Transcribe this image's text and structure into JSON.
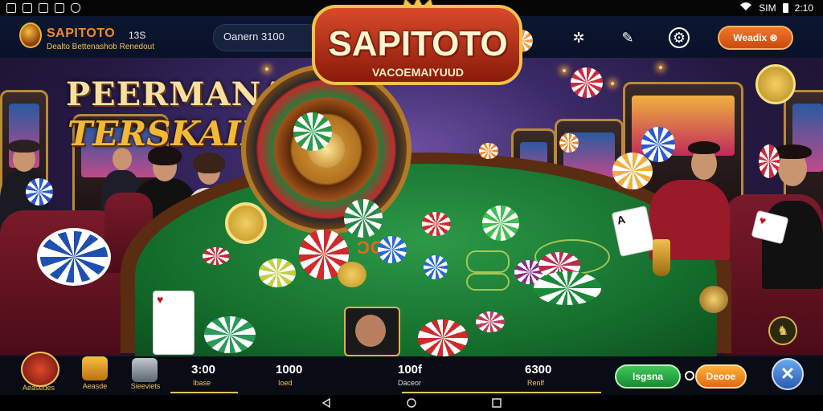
{
  "status_bar": {
    "left_icons": [
      "sim-icon",
      "photo-icon",
      "notification-icon",
      "app-icon",
      "shield-icon"
    ],
    "signal_text": "SIM",
    "time": "2:10"
  },
  "header": {
    "brand": "SAPITOTO",
    "brand_suffix": "13S",
    "brand_subtitle": "Dealto Bettenashob Renedout",
    "balance_text": "Oanern 3100",
    "menu_button": "Weadix"
  },
  "hero": {
    "title_line_1": "PEERMANAN",
    "title_line_2": "TERSKAIRO",
    "center_title": "SAPITOTO",
    "center_subtitle": "VACOEMAIYUUD",
    "felt_label": "ƆCO"
  },
  "bottom_bar": {
    "nav_items": [
      {
        "label": "Aeasedes"
      },
      {
        "label": "Aeasde"
      },
      {
        "label": "Sieeviets"
      }
    ],
    "stats": [
      {
        "value": "3:00",
        "sub": "Ibase"
      },
      {
        "value": "1000",
        "sub": "Ioed"
      },
      {
        "value": "100f",
        "sub": "Daceor"
      },
      {
        "value": "6300",
        "sub": "Renlf"
      }
    ],
    "green_button": "Isgsna",
    "orange_button": "Deooe"
  },
  "colors": {
    "accent_orange": "#e9641e",
    "gold": "#f3c35a",
    "felt_green": "#1e8a3a",
    "header_bg": "#0c1630"
  }
}
